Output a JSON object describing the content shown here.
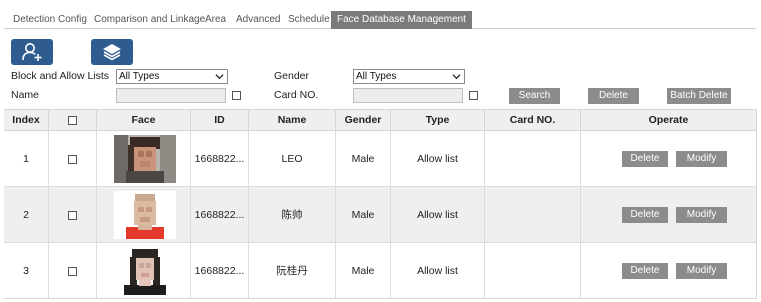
{
  "tabs": [
    {
      "label": "Detection Config",
      "active": false
    },
    {
      "label": "Comparison and Linkage",
      "active": false
    },
    {
      "label": "Area",
      "active": false
    },
    {
      "label": "Advanced",
      "active": false
    },
    {
      "label": "Schedule",
      "active": false
    },
    {
      "label": "Face Database Management",
      "active": true
    }
  ],
  "toolbar": {
    "add_icon": "add-person-icon",
    "layers_icon": "layers-icon",
    "accent_color": "#2f5c8e"
  },
  "filters": {
    "list_label": "Block and Allow Lists",
    "list_value": "All Types",
    "gender_label": "Gender",
    "gender_value": "All Types",
    "name_label": "Name",
    "name_value": "",
    "card_label": "Card NO.",
    "card_value": ""
  },
  "actions": {
    "search": "Search",
    "delete": "Delete",
    "batch_delete": "Batch Delete"
  },
  "table": {
    "columns": [
      "Index",
      "",
      "Face",
      "ID",
      "Name",
      "Gender",
      "Type",
      "Card NO.",
      "Operate"
    ],
    "rows": [
      {
        "index": "1",
        "id": "1668822...",
        "name": "LEO",
        "gender": "Male",
        "type": "Allow list",
        "card": "",
        "delete": "Delete",
        "modify": "Modify"
      },
      {
        "index": "2",
        "id": "1668822...",
        "name": "陈帅",
        "gender": "Male",
        "type": "Allow list",
        "card": "",
        "delete": "Delete",
        "modify": "Modify"
      },
      {
        "index": "3",
        "id": "1668822...",
        "name": "阮桂丹",
        "gender": "Male",
        "type": "Allow list",
        "card": "",
        "delete": "Delete",
        "modify": "Modify"
      }
    ]
  },
  "colors": {
    "button_gray": "#8c8c8c",
    "tab_active": "#7a7a7a",
    "row_alt": "#efefef"
  }
}
